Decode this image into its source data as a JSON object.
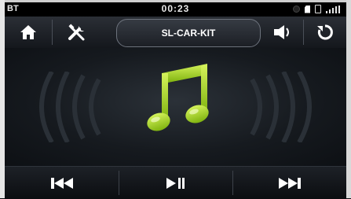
{
  "status": {
    "bt_label": "BT",
    "time": "00:23"
  },
  "nav": {
    "title": "SL-CAR-KIT",
    "home_icon": "home-icon",
    "settings_icon": "tools-icon",
    "volume_icon": "speaker-icon",
    "back_icon": "return-icon"
  },
  "main": {
    "art_icon": "music-note-icon",
    "accent": "#9bd11a"
  },
  "controls": {
    "prev_icon": "skip-previous-icon",
    "play_icon": "play-pause-icon",
    "next_icon": "skip-next-icon"
  }
}
